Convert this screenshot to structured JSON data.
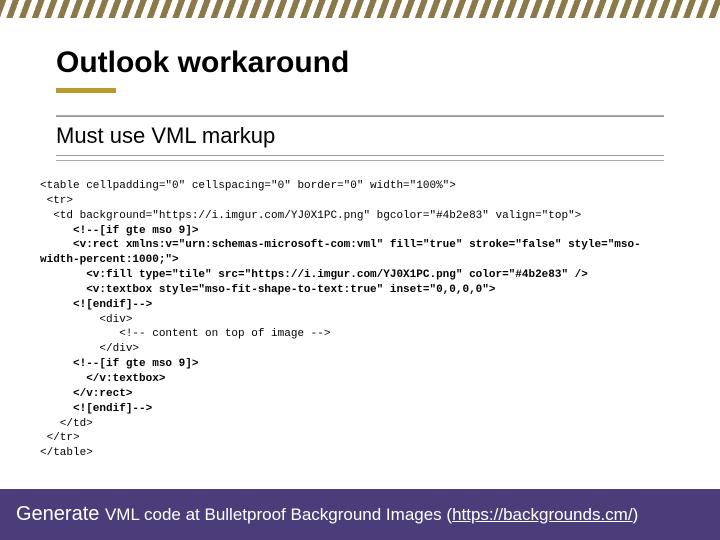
{
  "title": "Outlook workaround",
  "subtitle": "Must use VML markup",
  "code": {
    "l1": "<table cellpadding=\"0\" cellspacing=\"0\" border=\"0\" width=\"100%\">",
    "l2": " <tr>",
    "l3": "  <td background=\"https://i.imgur.com/YJ0X1PC.png\" bgcolor=\"#4b2e83\" valign=\"top\">",
    "l4": "     <!--[if gte mso 9]>",
    "l5a": "     <v:rect xmlns:v=\"urn:schemas-microsoft-com:vml\" fill=\"true\" stroke=\"false\" style=\"mso-",
    "l5b": "width-percent:1000;\">",
    "l6": "       <v:fill type=\"tile\" src=\"https://i.imgur.com/YJ0X1PC.png\" color=\"#4b2e83\" />",
    "l7": "       <v:textbox style=\"mso-fit-shape-to-text:true\" inset=\"0,0,0,0\">",
    "l8": "     <![endif]-->",
    "l9": "         <div>",
    "l10": "            <!-- content on top of image -->",
    "l11": "         </div>",
    "l12": "     <!--[if gte mso 9]>",
    "l13": "       </v:textbox>",
    "l14": "     </v:rect>",
    "l15": "     <![endif]-->",
    "l16": "   </td>",
    "l17": " </tr>",
    "l18": "</table>"
  },
  "footer": {
    "lead": "Generate ",
    "rest": "VML code at Bulletproof Background Images (",
    "link": "https://backgrounds.cm/",
    "close": ")"
  }
}
